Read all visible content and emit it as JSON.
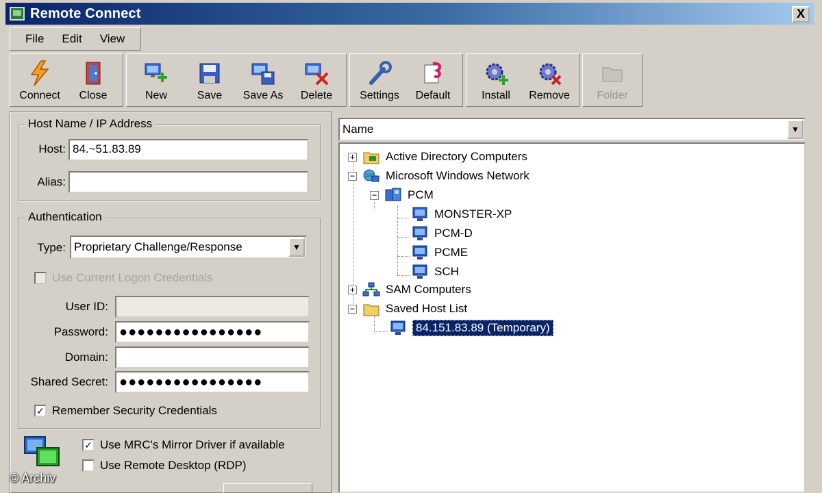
{
  "window": {
    "title": "Remote Connect",
    "close_glyph": "X"
  },
  "menu": [
    "File",
    "Edit",
    "View"
  ],
  "toolbar": {
    "groups": [
      [
        {
          "label": "Connect",
          "icon": "connect-bolt-icon",
          "enabled": true
        },
        {
          "label": "Close",
          "icon": "close-door-icon",
          "enabled": true
        }
      ],
      [
        {
          "label": "New",
          "icon": "new-host-icon",
          "enabled": true
        },
        {
          "label": "Save",
          "icon": "save-floppy-icon",
          "enabled": true
        },
        {
          "label": "Save As",
          "icon": "save-as-icon",
          "enabled": true
        },
        {
          "label": "Delete",
          "icon": "delete-host-icon",
          "enabled": true
        }
      ],
      [
        {
          "label": "Settings",
          "icon": "wrench-icon",
          "enabled": true
        },
        {
          "label": "Default",
          "icon": "default-flag-icon",
          "enabled": true
        }
      ],
      [
        {
          "label": "Install",
          "icon": "install-gear-icon",
          "enabled": true
        },
        {
          "label": "Remove",
          "icon": "remove-gear-icon",
          "enabled": true
        }
      ],
      [
        {
          "label": "Folder",
          "icon": "folder-icon",
          "enabled": false
        }
      ]
    ]
  },
  "host_group": {
    "title": "Host Name / IP Address",
    "host_label": "Host:",
    "host_value": "84.~51.83.89",
    "alias_label": "Alias:",
    "alias_value": ""
  },
  "auth_group": {
    "title": "Authentication",
    "type_label": "Type:",
    "type_value": "Proprietary Challenge/Response",
    "use_current_logon": "Use Current Logon Credentials",
    "user_id_label": "User ID:",
    "user_id_value": "",
    "password_label": "Password:",
    "password_value": "●●●●●●●●●●●●●●●●",
    "domain_label": "Domain:",
    "domain_value": "",
    "shared_secret_label": "Shared Secret:",
    "shared_secret_value": "●●●●●●●●●●●●●●●●",
    "remember_label": "Remember Security Credentials",
    "remember_checked": "✓"
  },
  "options": {
    "mirror_driver": "Use MRC's Mirror Driver if available",
    "mirror_checked": "✓",
    "rdp": "Use Remote Desktop (RDP)"
  },
  "tree_view": {
    "column_select": "Name",
    "nodes": [
      {
        "label": "Active Directory Computers",
        "expander": "+",
        "icon": "ad-computers-icon"
      },
      {
        "label": "Microsoft Windows Network",
        "expander": "−",
        "icon": "windows-network-icon"
      },
      {
        "label": "PCM",
        "expander": "−",
        "icon": "domain-group-icon"
      },
      {
        "label": "MONSTER-XP",
        "icon": "computer-monitor-icon"
      },
      {
        "label": "PCM-D",
        "icon": "computer-monitor-icon"
      },
      {
        "label": "PCME",
        "icon": "computer-monitor-icon"
      },
      {
        "label": "SCH",
        "icon": "computer-monitor-icon"
      },
      {
        "label": "SAM Computers",
        "expander": "+",
        "icon": "sam-network-icon"
      },
      {
        "label": "Saved Host List",
        "expander": "−",
        "icon": "folder-icon"
      },
      {
        "label": "84.151.83.89 (Temporary)",
        "icon": "computer-monitor-icon",
        "selected": true
      }
    ]
  },
  "watermark": "© Archiv",
  "colors": {
    "title_bar_start": "#0a246a",
    "title_bar_end": "#a6caf0",
    "selection": "#0a246a",
    "window_bg": "#d4d0c8"
  }
}
